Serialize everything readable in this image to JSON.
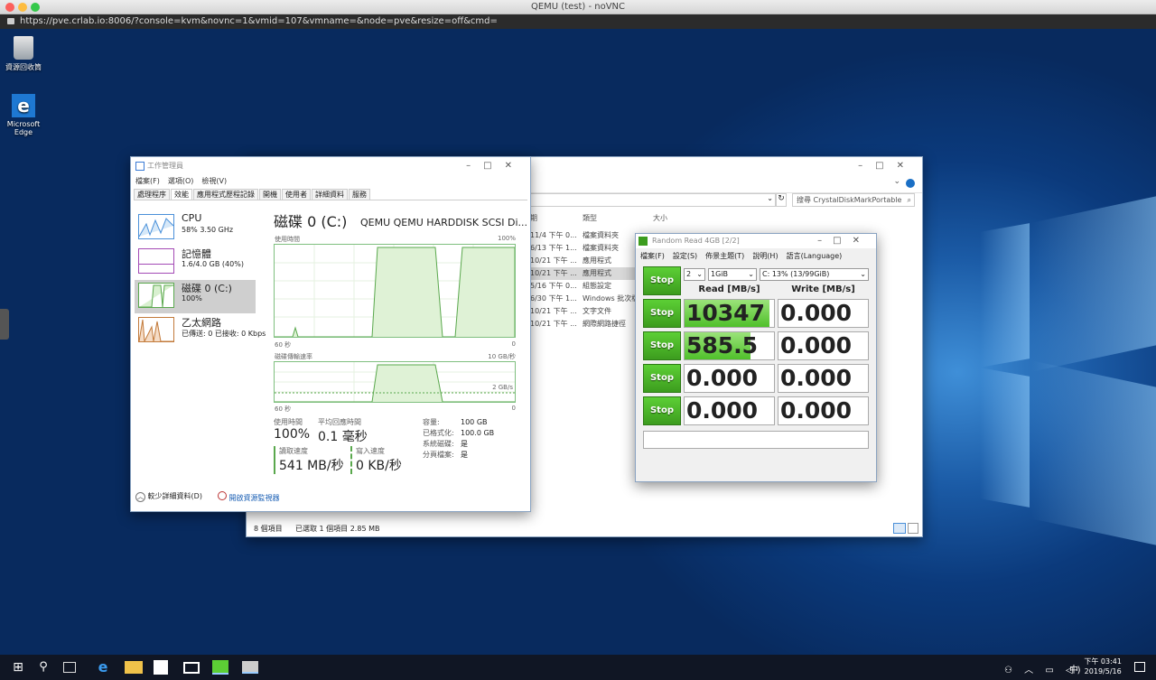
{
  "browser": {
    "window_title": "QEMU (test) - noVNC",
    "url": "https://pve.crlab.io:8006/?console=kvm&novnc=1&vmid=107&vmname=&node=pve&resize=off&cmd="
  },
  "desktop": {
    "icons": [
      {
        "label": "資源回收筒",
        "icon": "recycle-bin-icon"
      },
      {
        "label": "Microsoft Edge",
        "icon": "edge-icon"
      }
    ]
  },
  "explorer": {
    "search_placeholder": "搜尋 CrystalDiskMarkPortable",
    "columns": [
      "類型",
      "大小"
    ],
    "rows": [
      {
        "date": "11/4 下午 0...",
        "type": "檔案資料夾"
      },
      {
        "date": "6/13 下午 1...",
        "type": "檔案資料夾"
      },
      {
        "date": "10/21 下午 ...",
        "type": "應用程式"
      },
      {
        "date": "10/21 下午 ...",
        "type": "應用程式"
      },
      {
        "date": "5/16 下午 0...",
        "type": "組態設定"
      },
      {
        "date": "6/30 下午 1...",
        "type": "Windows 批次檔"
      },
      {
        "date": "10/21 下午 ...",
        "type": "文字文件"
      },
      {
        "date": "10/21 下午 ...",
        "type": "網際網路捷徑"
      }
    ],
    "status": {
      "items": "8 個項目",
      "selected": "已選取 1 個項目 2.85 MB"
    }
  },
  "taskmgr": {
    "title": "工作管理員",
    "menu": [
      "檔案(F)",
      "選項(O)",
      "檢視(V)"
    ],
    "tabs": [
      "處理程序",
      "效能",
      "應用程式歷程記錄",
      "開機",
      "使用者",
      "詳細資料",
      "服務"
    ],
    "side": [
      {
        "name": "CPU",
        "value": "58%  3.50 GHz"
      },
      {
        "name": "記憶體",
        "value": "1.6/4.0 GB (40%)"
      },
      {
        "name": "磁碟 0 (C:)",
        "value": "100%"
      },
      {
        "name": "乙太網路",
        "value": "已傳送: 0  已接收: 0 Kbps"
      }
    ],
    "main_title": "磁碟 0 (C:)",
    "model": "QEMU QEMU HARDDISK SCSI Di...",
    "graph1_label": "使用時間",
    "graph1_max": "100%",
    "graph1_time": "60 秒",
    "graph1_min": "0",
    "graph2_label": "磁碟傳輸速率",
    "graph2_max": "10 GB/秒",
    "graph2_mid": "2 GB/s",
    "graph2_time": "60 秒",
    "graph2_min": "0",
    "stats": {
      "active_label": "使用時間",
      "active_value": "100%",
      "resp_label": "平均回應時間",
      "resp_value": "0.1 毫秒",
      "read_label": "讀取速度",
      "read_value": "541 MB/秒",
      "write_label": "寫入速度",
      "write_value": "0 KB/秒"
    },
    "props": [
      {
        "k": "容量:",
        "v": "100 GB"
      },
      {
        "k": "已格式化:",
        "v": "100.0 GB"
      },
      {
        "k": "系統磁碟:",
        "v": "是"
      },
      {
        "k": "分頁檔案:",
        "v": "是"
      }
    ],
    "fewer_details": "較少詳細資料(D)",
    "open_monitor": "開啟資源監視器"
  },
  "crystal": {
    "title": "Random Read 4GB [2/2]",
    "menu": [
      "檔案(F)",
      "設定(S)",
      "佈景主題(T)",
      "說明(H)",
      "語言(Language)"
    ],
    "count": "2",
    "size": "1GiB",
    "drive": "C: 13% (13/99GiB)",
    "read_header": "Read [MB/s]",
    "write_header": "Write [MB/s]",
    "buttons": [
      "Stop",
      "Stop",
      "Stop",
      "Stop",
      "Stop"
    ],
    "rows": [
      {
        "read": "10347",
        "write": "0.000",
        "read_fill": 0.95
      },
      {
        "read": "585.5",
        "write": "0.000",
        "read_fill": 0.74
      },
      {
        "read": "0.000",
        "write": "0.000",
        "read_fill": 0
      },
      {
        "read": "0.000",
        "write": "0.000",
        "read_fill": 0
      }
    ]
  },
  "taskbar": {
    "time": "下午 03:41",
    "date": "2019/5/16",
    "ime": "中"
  }
}
